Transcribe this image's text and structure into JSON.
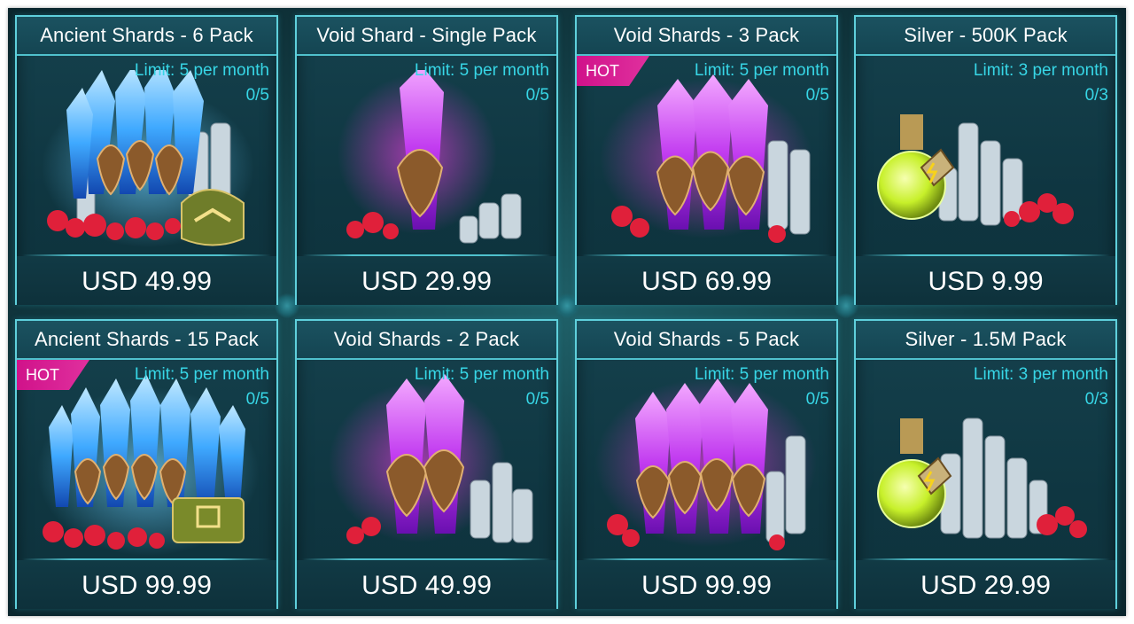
{
  "store": {
    "cards": [
      {
        "title": "Ancient Shards - 6 Pack",
        "limit": "Limit: 5 per month",
        "count": "0/5",
        "price": "USD 49.99",
        "hot": "",
        "art": "ancient-shards-icon"
      },
      {
        "title": "Void Shard - Single Pack",
        "limit": "Limit: 5 per month",
        "count": "0/5",
        "price": "USD 29.99",
        "hot": "",
        "art": "void-shard-icon"
      },
      {
        "title": "Void Shards - 3 Pack",
        "limit": "Limit: 5 per month",
        "count": "0/5",
        "price": "USD 69.99",
        "hot": "HOT",
        "art": "void-shards-icon"
      },
      {
        "title": "Silver - 500K Pack",
        "limit": "Limit: 3 per month",
        "count": "0/3",
        "price": "USD 9.99",
        "hot": "",
        "art": "silver-potion-icon"
      },
      {
        "title": "Ancient Shards - 15 Pack",
        "limit": "Limit: 5 per month",
        "count": "0/5",
        "price": "USD 99.99",
        "hot": "HOT",
        "art": "ancient-shards-icon"
      },
      {
        "title": "Void Shards - 2 Pack",
        "limit": "Limit: 5 per month",
        "count": "0/5",
        "price": "USD 49.99",
        "hot": "",
        "art": "void-shards-icon"
      },
      {
        "title": "Void Shards - 5 Pack",
        "limit": "Limit: 5 per month",
        "count": "0/5",
        "price": "USD 99.99",
        "hot": "",
        "art": "void-shards-icon"
      },
      {
        "title": "Silver - 1.5M Pack",
        "limit": "Limit: 3 per month",
        "count": "0/3",
        "price": "USD 29.99",
        "hot": "",
        "art": "silver-potion-icon"
      }
    ]
  },
  "colors": {
    "ancient": "#3fa9ff",
    "void": "#c23cf0",
    "silver_potion": "#c7f02a",
    "hot": "#d0128a",
    "accent": "#37d6e6"
  }
}
